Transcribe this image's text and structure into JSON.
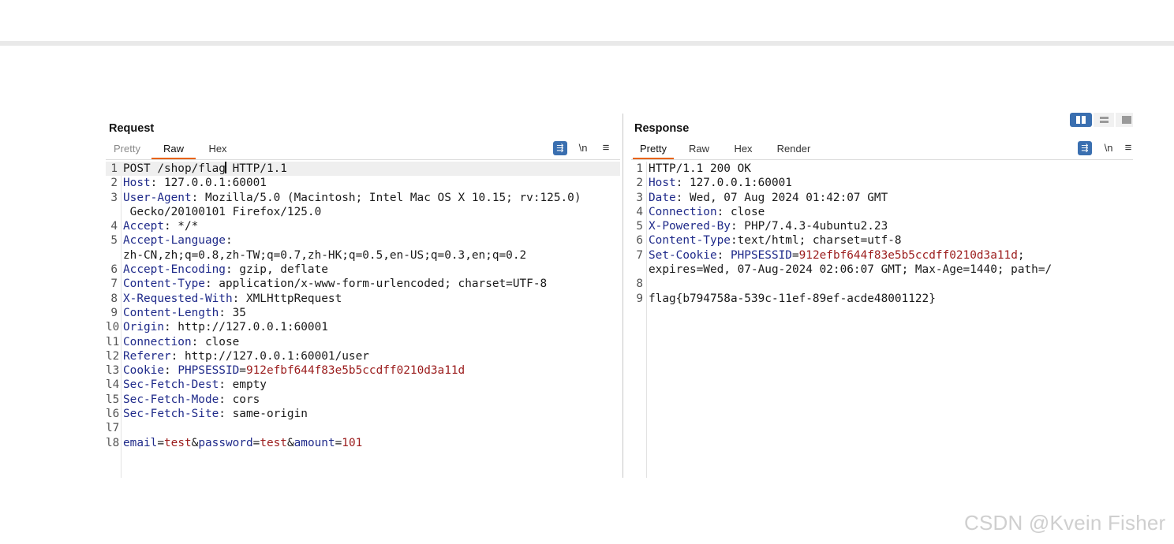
{
  "request": {
    "title": "Request",
    "tabs": [
      "Pretty",
      "Raw",
      "Hex"
    ],
    "active_tab": "Raw",
    "tools": {
      "newline_label": "\\n",
      "menu_glyph": "≡",
      "wrap_glyph": "⇶"
    },
    "lines": [
      {
        "n": "1",
        "segs": [
          {
            "t": "POST /shop/flag",
            "c": ""
          },
          {
            "t": "|caret|",
            "c": "caret"
          },
          {
            "t": " HTTP/1.1",
            "c": ""
          }
        ],
        "hl": true
      },
      {
        "n": "2",
        "segs": [
          {
            "t": "Host",
            "c": "k"
          },
          {
            "t": ": 127.0.0.1:60001",
            "c": ""
          }
        ]
      },
      {
        "n": "3",
        "segs": [
          {
            "t": "User-Agent",
            "c": "k"
          },
          {
            "t": ": Mozilla/5.0 (Macintosh; Intel Mac OS X 10.15; rv:125.0)",
            "c": ""
          }
        ]
      },
      {
        "n": "",
        "segs": [
          {
            "t": " Gecko/20100101 Firefox/125.0",
            "c": ""
          }
        ]
      },
      {
        "n": "4",
        "segs": [
          {
            "t": "Accept",
            "c": "k"
          },
          {
            "t": ": */*",
            "c": ""
          }
        ]
      },
      {
        "n": "5",
        "segs": [
          {
            "t": "Accept-Language",
            "c": "k"
          },
          {
            "t": ":",
            "c": ""
          }
        ]
      },
      {
        "n": "",
        "segs": [
          {
            "t": "zh-CN,zh;q=0.8,zh-TW;q=0.7,zh-HK;q=0.5,en-US;q=0.3,en;q=0.2",
            "c": ""
          }
        ]
      },
      {
        "n": "6",
        "segs": [
          {
            "t": "Accept-Encoding",
            "c": "k"
          },
          {
            "t": ": gzip, deflate",
            "c": ""
          }
        ]
      },
      {
        "n": "7",
        "segs": [
          {
            "t": "Content-Type",
            "c": "k"
          },
          {
            "t": ": application/x-www-form-urlencoded; charset=UTF-8",
            "c": ""
          }
        ]
      },
      {
        "n": "8",
        "segs": [
          {
            "t": "X-Requested-With",
            "c": "k"
          },
          {
            "t": ": XMLHttpRequest",
            "c": ""
          }
        ]
      },
      {
        "n": "9",
        "segs": [
          {
            "t": "Content-Length",
            "c": "k"
          },
          {
            "t": ": 35",
            "c": ""
          }
        ]
      },
      {
        "n": "l0",
        "segs": [
          {
            "t": "Origin",
            "c": "k"
          },
          {
            "t": ": http://127.0.0.1:60001",
            "c": ""
          }
        ]
      },
      {
        "n": "l1",
        "segs": [
          {
            "t": "Connection",
            "c": "k"
          },
          {
            "t": ": close",
            "c": ""
          }
        ]
      },
      {
        "n": "l2",
        "segs": [
          {
            "t": "Referer",
            "c": "k"
          },
          {
            "t": ": http://127.0.0.1:60001/user",
            "c": ""
          }
        ]
      },
      {
        "n": "l3",
        "segs": [
          {
            "t": "Cookie",
            "c": "k"
          },
          {
            "t": ": ",
            "c": ""
          },
          {
            "t": "PHPSESSID",
            "c": "k"
          },
          {
            "t": "=",
            "c": ""
          },
          {
            "t": "912efbf644f83e5b5ccdff0210d3a11d",
            "c": "v"
          }
        ]
      },
      {
        "n": "l4",
        "segs": [
          {
            "t": "Sec-Fetch-Dest",
            "c": "k"
          },
          {
            "t": ": empty",
            "c": ""
          }
        ]
      },
      {
        "n": "l5",
        "segs": [
          {
            "t": "Sec-Fetch-Mode",
            "c": "k"
          },
          {
            "t": ": cors",
            "c": ""
          }
        ]
      },
      {
        "n": "l6",
        "segs": [
          {
            "t": "Sec-Fetch-Site",
            "c": "k"
          },
          {
            "t": ": same-origin",
            "c": ""
          }
        ]
      },
      {
        "n": "l7",
        "segs": []
      },
      {
        "n": "l8",
        "segs": [
          {
            "t": "email",
            "c": "k"
          },
          {
            "t": "=",
            "c": ""
          },
          {
            "t": "test",
            "c": "v"
          },
          {
            "t": "&",
            "c": ""
          },
          {
            "t": "password",
            "c": "k"
          },
          {
            "t": "=",
            "c": ""
          },
          {
            "t": "test",
            "c": "v"
          },
          {
            "t": "&",
            "c": ""
          },
          {
            "t": "amount",
            "c": "k"
          },
          {
            "t": "=",
            "c": ""
          },
          {
            "t": "101",
            "c": "v"
          }
        ]
      }
    ]
  },
  "response": {
    "title": "Response",
    "tabs": [
      "Pretty",
      "Raw",
      "Hex",
      "Render"
    ],
    "active_tab": "Pretty",
    "tools": {
      "newline_label": "\\n",
      "menu_glyph": "≡",
      "wrap_glyph": "⇶"
    },
    "lines": [
      {
        "n": "1",
        "segs": [
          {
            "t": "HTTP/1.1 200 OK",
            "c": ""
          }
        ]
      },
      {
        "n": "2",
        "segs": [
          {
            "t": "Host",
            "c": "k"
          },
          {
            "t": ": 127.0.0.1:60001",
            "c": ""
          }
        ]
      },
      {
        "n": "3",
        "segs": [
          {
            "t": "Date",
            "c": "k"
          },
          {
            "t": ": Wed, 07 Aug 2024 01:42:07 GMT",
            "c": ""
          }
        ]
      },
      {
        "n": "4",
        "segs": [
          {
            "t": "Connection",
            "c": "k"
          },
          {
            "t": ": close",
            "c": ""
          }
        ]
      },
      {
        "n": "5",
        "segs": [
          {
            "t": "X-Powered-By",
            "c": "k"
          },
          {
            "t": ": PHP/7.4.3-4ubuntu2.23",
            "c": ""
          }
        ]
      },
      {
        "n": "6",
        "segs": [
          {
            "t": "Content-Type",
            "c": "k"
          },
          {
            "t": ":text/html; charset=utf-8",
            "c": ""
          }
        ]
      },
      {
        "n": "7",
        "segs": [
          {
            "t": "Set-Cookie",
            "c": "k"
          },
          {
            "t": ": ",
            "c": ""
          },
          {
            "t": "PHPSESSID",
            "c": "k"
          },
          {
            "t": "=",
            "c": ""
          },
          {
            "t": "912efbf644f83e5b5ccdff0210d3a11d",
            "c": "v"
          },
          {
            "t": ";",
            "c": ""
          }
        ]
      },
      {
        "n": "",
        "segs": [
          {
            "t": "expires=Wed, 07-Aug-2024 02:06:07 GMT; Max-Age=1440; path=/",
            "c": ""
          }
        ]
      },
      {
        "n": "8",
        "segs": []
      },
      {
        "n": "9",
        "segs": [
          {
            "t": "flag{b794758a-539c-11ef-89ef-acde48001122}",
            "c": ""
          }
        ]
      }
    ]
  },
  "watermark": "CSDN @Kvein Fisher",
  "colors": {
    "accent": "#e8630a",
    "key": "#1f2a8a",
    "value": "#9b1c1c",
    "toggle": "#3a6fb0"
  },
  "icons": [
    "wrap-lines-icon",
    "newline-toggle-icon",
    "menu-icon",
    "layout-toggle-icon"
  ]
}
